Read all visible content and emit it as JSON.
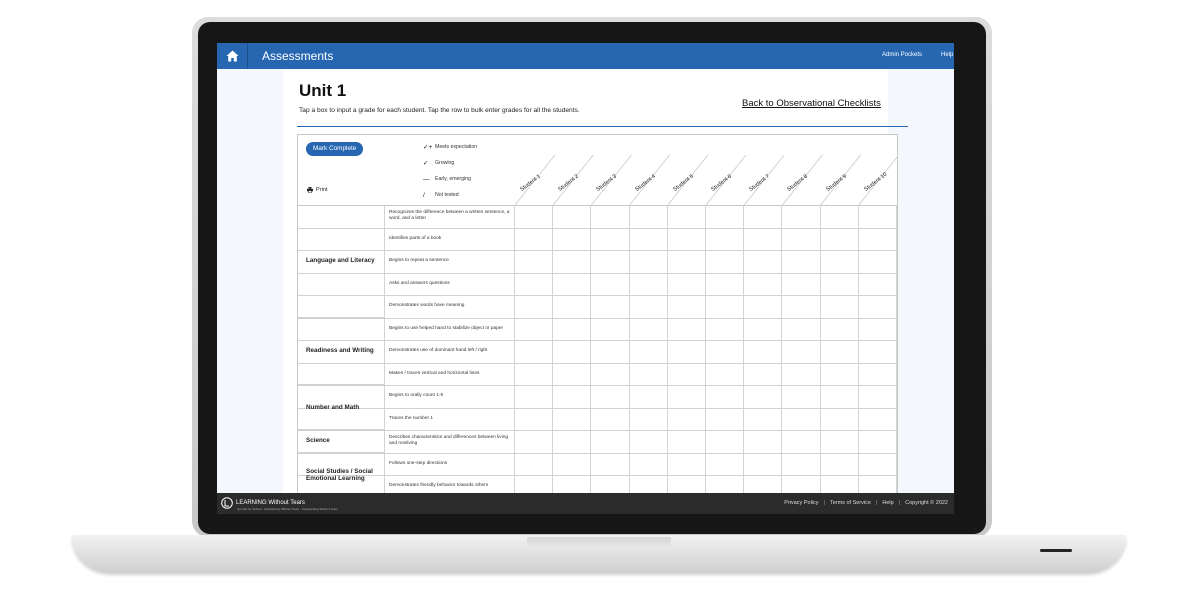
{
  "header": {
    "title": "Assessments",
    "links": [
      "Admin Pockets",
      "Help"
    ]
  },
  "page": {
    "title": "Unit 1",
    "instructions": "Tap a box to input a grade for each student. Tap the row to bulk enter grades for all the students.",
    "back_link": "Back to Observational Checklists"
  },
  "toolbar": {
    "mark_complete": "Mark Complete",
    "print": "Print"
  },
  "legend": [
    {
      "symbol": "✓+",
      "label": "Meets expectation"
    },
    {
      "symbol": "✓",
      "label": "Growing"
    },
    {
      "symbol": "—",
      "label": "Early, emerging"
    },
    {
      "symbol": "/",
      "label": "Not tested"
    }
  ],
  "students": [
    "Student 1",
    "Student 2",
    "Student 3",
    "Student 4",
    "Student 5",
    "Student 6",
    "Student 7",
    "Student 8",
    "Student 9",
    "Student 10"
  ],
  "categories": [
    {
      "name": "Language and Literacy",
      "skills": [
        "Recognizes the difference between a written sentence, a word, and a letter",
        "Identifies parts of a book",
        "Begins to repeat a sentence",
        "Asks and answers questions",
        "Demonstrates words have meaning"
      ]
    },
    {
      "name": "Readiness and Writing",
      "skills": [
        "Begins to use helped hand to stabilize object or paper",
        "Demonstrates use of dominant hand left / right",
        "Makes / traces vertical and horizontal lines"
      ]
    },
    {
      "name": "Number and Math",
      "skills": [
        "Begins to orally count 1-5",
        "Traces the number 1"
      ]
    },
    {
      "name": "Science",
      "skills": [
        "Describes characteristics and differences between living and nonliving"
      ]
    },
    {
      "name": "Social Studies / Social Emotional Learning",
      "skills": [
        "Follows one-step directions",
        "Demonstrates friendly behavior towards others"
      ]
    }
  ],
  "footer": {
    "brand": "LEARNING Without Tears",
    "brand_sub": "Get Set for School · Handwriting Without Tears · Keyboarding Without Tears",
    "links": [
      "Privacy Policy",
      "Terms of Service",
      "Help",
      "Copyright © 2022"
    ]
  },
  "colors": {
    "accent": "#2767b2",
    "footer_bg": "#2b2b2b"
  }
}
